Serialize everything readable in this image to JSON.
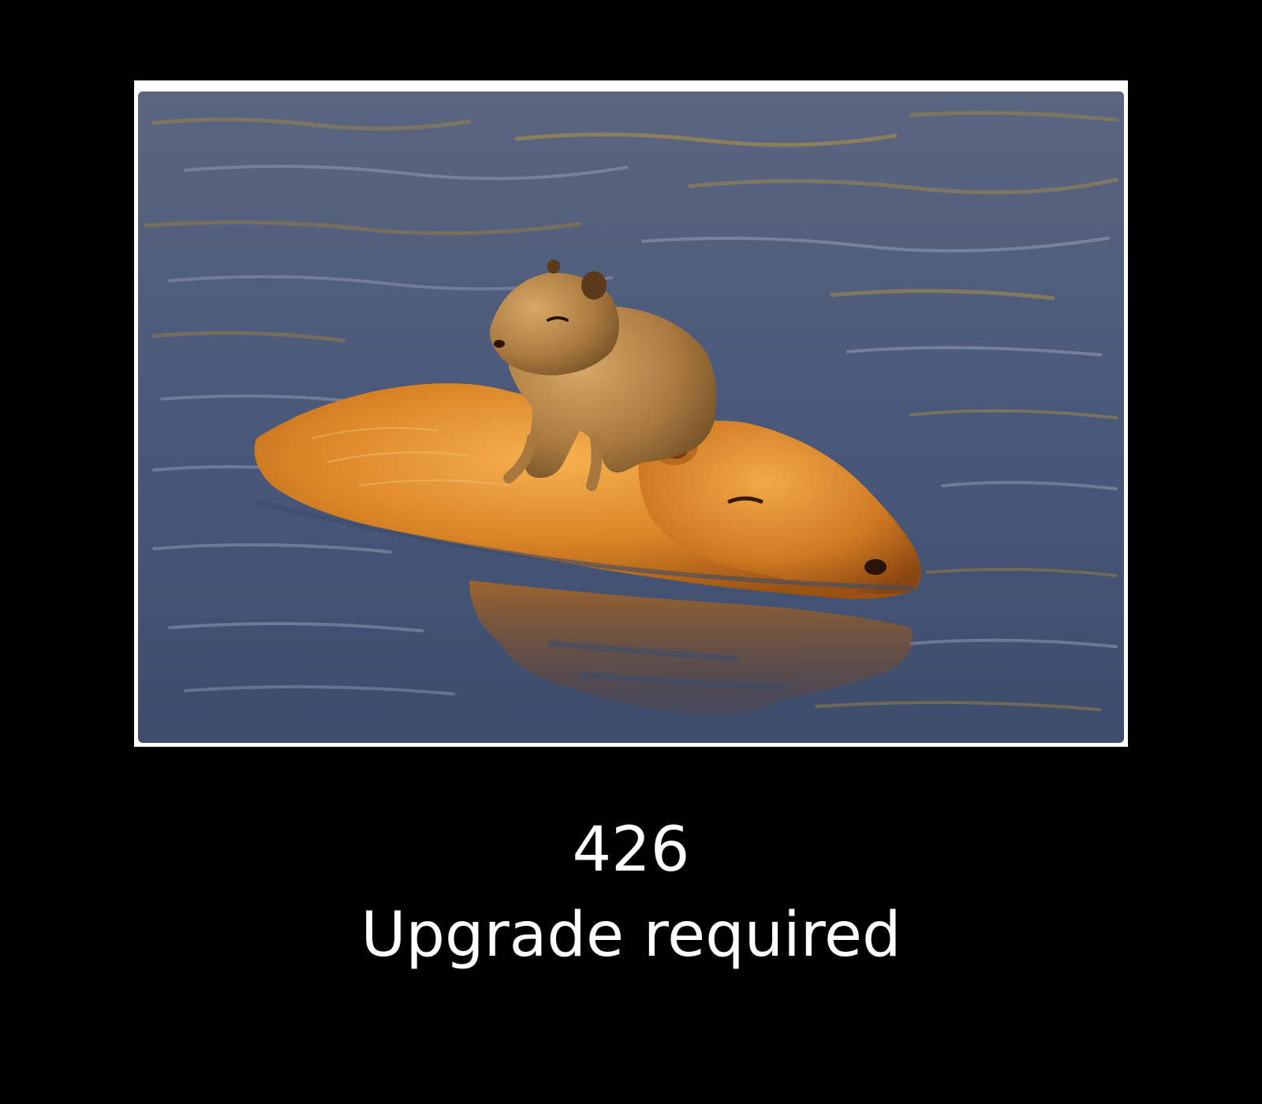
{
  "error": {
    "code": "426",
    "message": "Upgrade required"
  },
  "photo": {
    "subject": "capybara-with-baby-in-water-icon",
    "colors": {
      "water": "#4a5a7a",
      "water_light": "#7a88a6",
      "ripple_gold": "#b8913e",
      "fur": "#d98a2a",
      "fur_light": "#f0a848",
      "fur_dark": "#8a4a10",
      "baby_fur": "#b88a4a"
    }
  }
}
